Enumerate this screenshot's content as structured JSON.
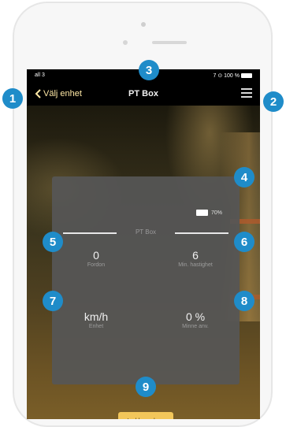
{
  "status_bar": {
    "signal": "all 3",
    "right": "7 ⊙ 100 %"
  },
  "nav": {
    "back_label": "Välj enhet",
    "title": "PT Box"
  },
  "panel": {
    "battery": "70%",
    "device_label": "PT Box",
    "stats": [
      {
        "value": "0",
        "label": "Fordon"
      },
      {
        "value": "6",
        "label": "Min. hastighet"
      },
      {
        "value": "km/h",
        "label": "Enhet"
      },
      {
        "value": "0 %",
        "label": "Minne anv."
      }
    ],
    "download_label": "Ladda ner logg"
  },
  "badges": [
    "1",
    "2",
    "3",
    "4",
    "5",
    "6",
    "7",
    "8",
    "9"
  ],
  "colors": {
    "badge": "#1f8cc9",
    "download_button": "#f2c65a",
    "back_accent": "#ffe9a6"
  }
}
